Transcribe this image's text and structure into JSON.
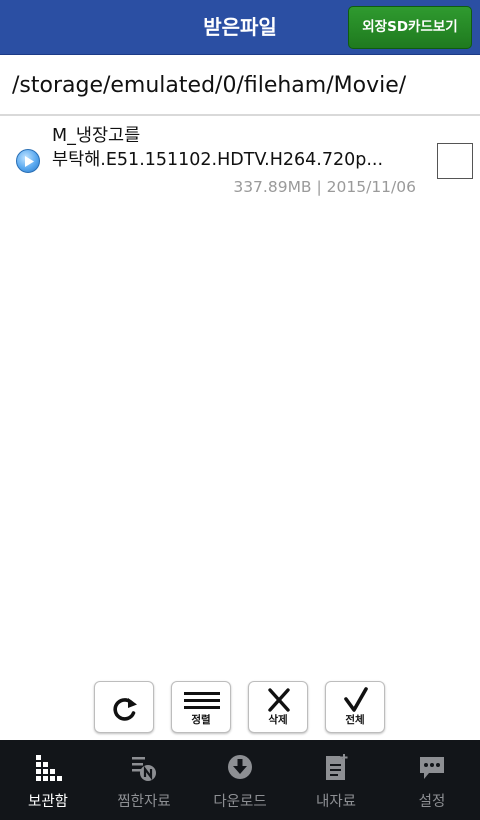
{
  "header": {
    "title": "받은파일",
    "sd_button_label": "외장SD카드보기"
  },
  "path": "/storage/emulated/0/fileham/Movie/",
  "files": [
    {
      "name_line1": "M_냉장고를",
      "name_line2": "부탁해.E51.151102.HDTV.H264.720p...",
      "size": "337.89MB",
      "separator": " | ",
      "date": "2015/11/06",
      "checked": false,
      "icon": "play-icon"
    }
  ],
  "actions": {
    "refresh": {
      "label": "",
      "icon": "refresh-icon"
    },
    "sort": {
      "label": "정렬",
      "icon": "sort-lines-icon"
    },
    "delete": {
      "label": "삭제",
      "icon": "x-icon"
    },
    "select_all": {
      "label": "전체",
      "icon": "check-icon"
    }
  },
  "bottom_nav": {
    "items": [
      {
        "label": "보관함",
        "icon": "storage-icon",
        "active": true
      },
      {
        "label": "찜한자료",
        "icon": "favorites-list-icon",
        "active": false
      },
      {
        "label": "다운로드",
        "icon": "download-icon",
        "active": false
      },
      {
        "label": "내자료",
        "icon": "my-files-icon",
        "active": false
      },
      {
        "label": "설정",
        "icon": "settings-chat-icon",
        "active": false
      }
    ]
  },
  "colors": {
    "header_bg": "#2b4fa3",
    "sd_button_bg": "#24842a",
    "nav_bg": "#121519",
    "meta_text": "#9a9a9a",
    "play_icon": "#5aa9f0"
  }
}
